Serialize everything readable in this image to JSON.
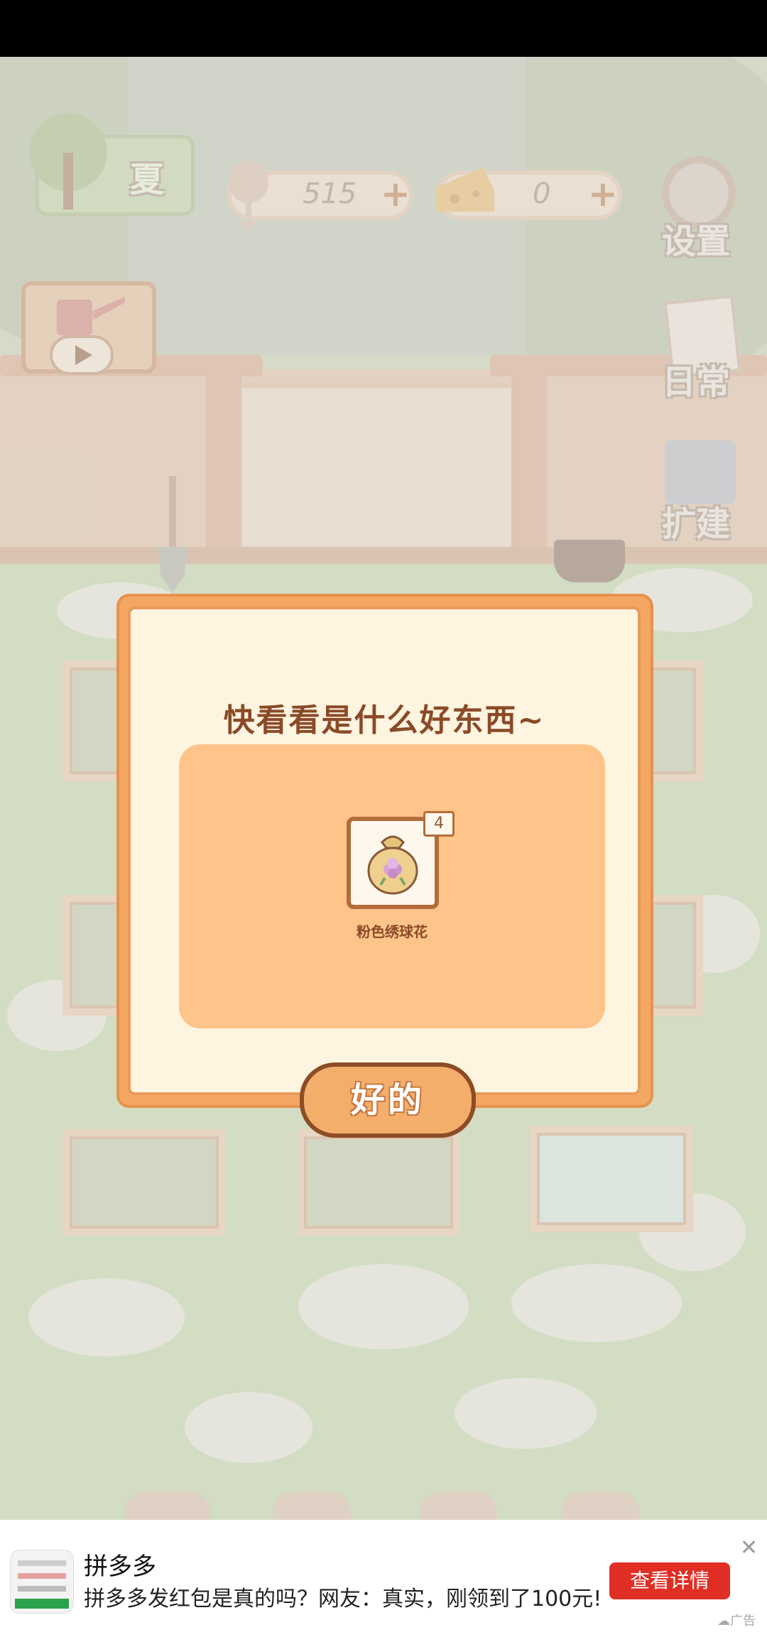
{
  "hud": {
    "season_label": "夏",
    "fish_count": "515",
    "cheese_count": "0",
    "settings_label": "设置",
    "daily_label": "日常",
    "expand_label": "扩建"
  },
  "dialog": {
    "title": "快看看是什么好东西~",
    "item_name": "粉色绣球花",
    "item_count": "4",
    "ok_label": "好的"
  },
  "ad": {
    "app_name": "拼多多",
    "description": "拼多多发红包是真的吗？网友：真实，刚领到了100元!",
    "cta_label": "查看详情",
    "tag_label": "广告"
  }
}
